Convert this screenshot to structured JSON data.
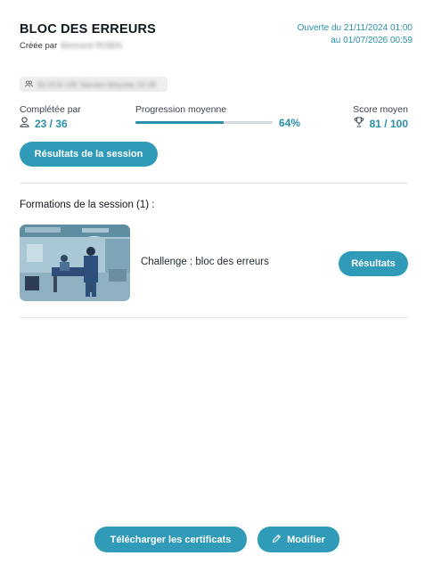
{
  "header": {
    "title": "BLOC DES ERREURS",
    "created_by_label": "Créée par",
    "created_by_name": "Bertrand ROBIN",
    "date_line1": "Ouverte du 21/11/2024 01:00",
    "date_line2": "au 01/07/2026 00:59"
  },
  "group": {
    "icon": "group-icon",
    "label": "BLOCK-VIE Namles Mayotte 24-36"
  },
  "stats": {
    "completed_label": "Complétée par",
    "completed_value": "23 / 36",
    "completed_icon": "user-icon",
    "progress_label": "Progression moyenne",
    "progress_value": "64%",
    "progress_fraction": 0.64,
    "score_label": "Score moyen",
    "score_value": "81 / 100",
    "score_icon": "trophy-icon"
  },
  "session_results_button": "Résultats de la session",
  "courses": {
    "title": "Formations de la session (1) :",
    "items": [
      {
        "name": "Challenge : bloc des erreurs",
        "button": "Résultats"
      }
    ]
  },
  "footer": {
    "download_button": "Télécharger les certificats",
    "edit_button": "Modifier",
    "edit_icon": "pencil-icon"
  },
  "colors": {
    "accent": "#2f9bb8",
    "accent_text": "#2a8fa8"
  }
}
